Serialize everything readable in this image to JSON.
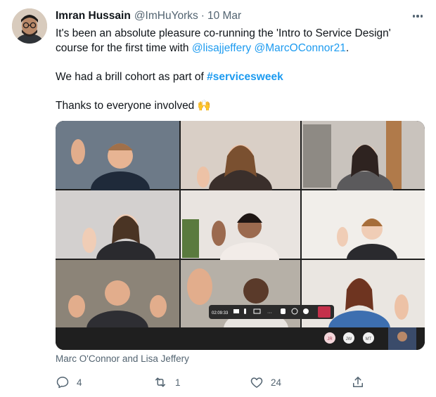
{
  "tweet": {
    "author_name": "Imran Hussain",
    "author_handle": "@ImHuYorks",
    "separator": "·",
    "date": "10 Mar",
    "line1": "It's been an absolute pleasure co-running the 'Intro to Service Design'",
    "line2_prefix": "course for the first time with ",
    "mention1": "@lisajjeffery",
    "mention2": "@MarcOConnor21",
    "line2_suffix": ".",
    "line3_prefix": "We had a brill cohort as part of ",
    "hashtag": "#servicesweek",
    "line4": "Thanks to everyone involved",
    "emoji": "🙌"
  },
  "media": {
    "call_time": "02:09:33",
    "participants": [
      "JR",
      "JW",
      "MT"
    ],
    "image_caption": "Marc O'Connor and Lisa Jeffery"
  },
  "actions": {
    "reply_count": "4",
    "retweet_count": "1",
    "like_count": "24"
  },
  "icons": {
    "more": "more-horizontal-icon",
    "reply": "reply-icon",
    "retweet": "retweet-icon",
    "like": "heart-icon",
    "share": "share-icon"
  },
  "colors": {
    "link": "#1d9bf0",
    "secondary": "#536471",
    "text": "#0f1419",
    "end_call": "#c4314b"
  }
}
